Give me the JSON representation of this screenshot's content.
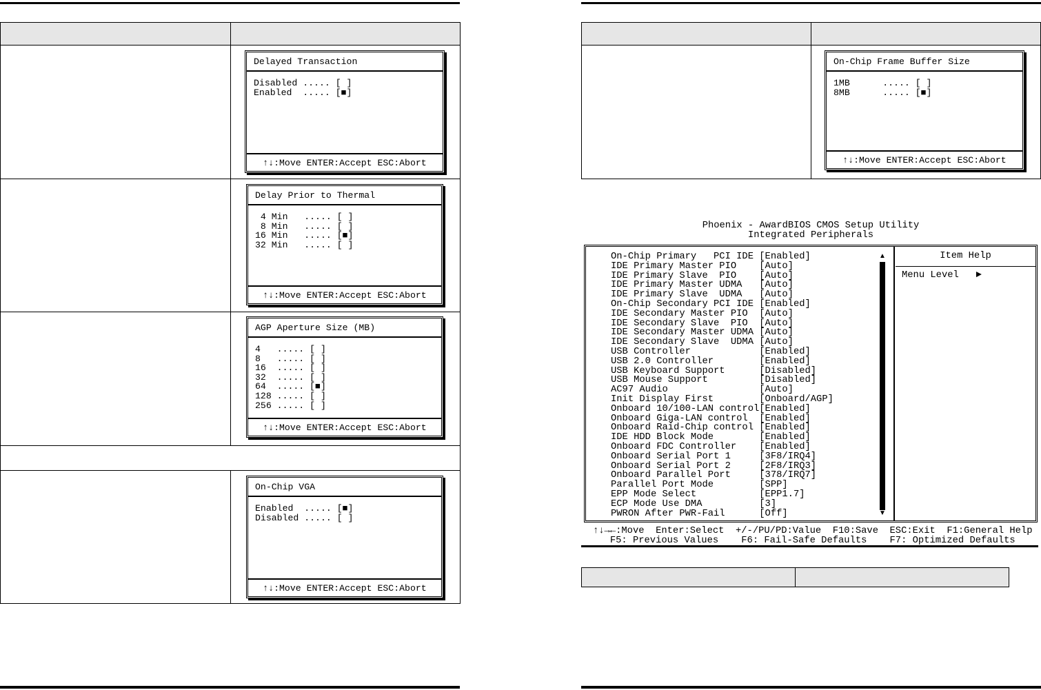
{
  "left_page": {
    "popups": [
      {
        "title": "Delayed Transaction",
        "options": [
          "Disabled ..... [ ]",
          "Enabled  ..... [■]"
        ],
        "footer": "↑↓:Move ENTER:Accept ESC:Abort"
      },
      {
        "title": "Delay Prior to Thermal",
        "options": [
          " 4 Min   ..... [ ]",
          " 8 Min   ..... [ ]",
          "16 Min   ..... [■]",
          "32 Min   ..... [ ]"
        ],
        "footer": "↑↓:Move ENTER:Accept ESC:Abort"
      },
      {
        "title": "AGP Aperture Size (MB)",
        "options": [
          "4   ..... [ ]",
          "8   ..... [ ]",
          "16  ..... [ ]",
          "32  ..... [ ]",
          "64  ..... [■]",
          "128 ..... [ ]",
          "256 ..... [ ]"
        ],
        "footer": "↑↓:Move ENTER:Accept ESC:Abort"
      },
      {
        "title": "On-Chip VGA",
        "options": [
          "Enabled  ..... [■]",
          "Disabled ..... [ ]"
        ],
        "footer": "↑↓:Move ENTER:Accept ESC:Abort"
      }
    ]
  },
  "right_page": {
    "popup": {
      "title": "On-Chip Frame Buffer Size",
      "options": [
        "1MB      ..... [ ]",
        "8MB      ..... [■]"
      ],
      "footer": "↑↓:Move ENTER:Accept ESC:Abort"
    },
    "bios": {
      "title": "Phoenix - AwardBIOS CMOS Setup Utility",
      "subtitle": "Integrated Peripherals",
      "items": [
        [
          "On-Chip Primary   PCI IDE",
          "[Enabled]"
        ],
        [
          "IDE Primary Master PIO",
          "[Auto]"
        ],
        [
          "IDE Primary Slave  PIO",
          "[Auto]"
        ],
        [
          "IDE Primary Master UDMA",
          "[Auto]"
        ],
        [
          "IDE Primary Slave  UDMA",
          "[Auto]"
        ],
        [
          "On-Chip Secondary PCI IDE",
          "[Enabled]"
        ],
        [
          "IDE Secondary Master PIO",
          "[Auto]"
        ],
        [
          "IDE Secondary Slave  PIO",
          "[Auto]"
        ],
        [
          "IDE Secondary Master UDMA",
          "[Auto]"
        ],
        [
          "IDE Secondary Slave  UDMA",
          "[Auto]"
        ],
        [
          "USB Controller",
          "[Enabled]"
        ],
        [
          "USB 2.0 Controller",
          "[Enabled]"
        ],
        [
          "USB Keyboard Support",
          "[Disabled]"
        ],
        [
          "USB Mouse Support",
          "[Disabled]"
        ],
        [
          "AC97 Audio",
          "[Auto]"
        ],
        [
          "Init Display First",
          "[Onboard/AGP]"
        ],
        [
          "Onboard 10/100-LAN control",
          "[Enabled]"
        ],
        [
          "Onboard Giga-LAN control",
          "[Enabled]"
        ],
        [
          "Onboard Raid-Chip control",
          "[Enabled]"
        ],
        [
          "IDE HDD Block Mode",
          "[Enabled]"
        ],
        [
          "Onboard FDC Controller",
          "[Enabled]"
        ],
        [
          "Onboard Serial Port 1",
          "[3F8/IRQ4]"
        ],
        [
          "Onboard Serial Port 2",
          "[2F8/IRQ3]"
        ],
        [
          "Onboard Parallel Port",
          "[378/IRQ7]"
        ],
        [
          "Parallel Port Mode",
          "[SPP]"
        ],
        [
          "EPP Mode Select",
          "[EPP1.7]"
        ],
        [
          "ECP Mode Use DMA",
          "[3]"
        ],
        [
          "PWRON After PWR-Fail",
          "[Off]"
        ]
      ],
      "item_help": "Item Help",
      "menu_level": "Menu Level   ►",
      "footer_line1": "↑↓→←:Move  Enter:Select  +/-/PU/PD:Value  F10:Save  ESC:Exit  F1:General Help",
      "footer_line2": "   F5: Previous Values    F6: Fail-Safe Defaults    F7: Optimized Defaults"
    }
  }
}
